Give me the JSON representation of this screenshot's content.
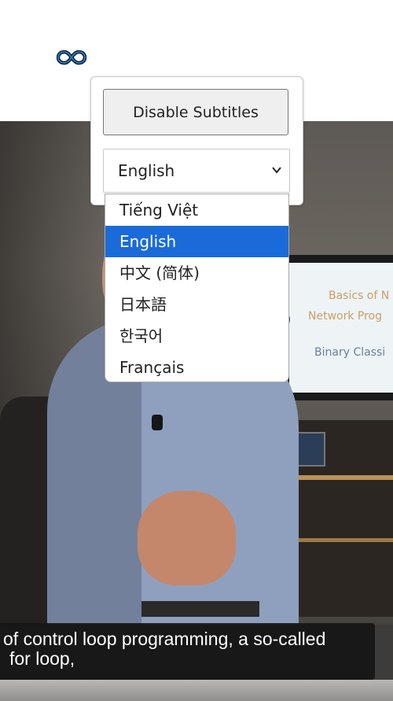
{
  "header": {
    "logo_icon": "infinity-loop-logo-icon"
  },
  "subtitles_menu": {
    "disable_button_label": "Disable Subtitles",
    "selected_language": "English",
    "dropdown_icon": "chevron-down-icon",
    "options": [
      "Tiếng Việt",
      "English",
      "中文 (简体)",
      "日本語",
      "한국어",
      "Français"
    ],
    "highlighted_option": "English"
  },
  "video": {
    "slide_text": {
      "line1": "Basics of N",
      "line2": "Network Prog",
      "line3": "Binary Classi"
    },
    "caption": {
      "line1": "of control loop programming, a so-called",
      "line2": "for loop,"
    }
  },
  "colors": {
    "highlight": "#1a6bd9",
    "caption_bg": "#161616",
    "logo_blue": "#1f78d1"
  }
}
